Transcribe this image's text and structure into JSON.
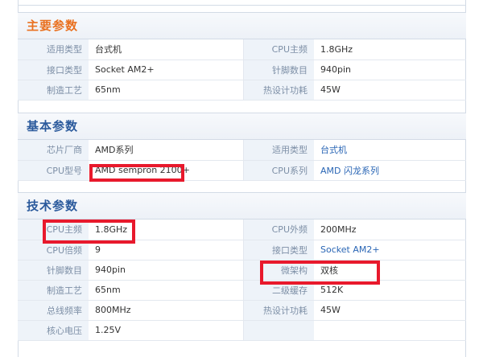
{
  "sections": [
    {
      "title": "主要参数",
      "rows": [
        {
          "k1": "适用类型",
          "v1": "台式机",
          "k2": "CPU主频",
          "v2": "1.8GHz"
        },
        {
          "k1": "接口类型",
          "v1": "Socket AM2+",
          "k2": "针脚数目",
          "v2": "940pin"
        },
        {
          "k1": "制造工艺",
          "v1": "65nm",
          "k2": "热设计功耗",
          "v2": "45W"
        }
      ]
    },
    {
      "title": "基本参数",
      "rows": [
        {
          "k1": "芯片厂商",
          "v1": "AMD系列",
          "k2": "适用类型",
          "v2": "台式机"
        },
        {
          "k1": "CPU型号",
          "v1": "AMD sempron 2100+",
          "k2": "CPU系列",
          "v2": "AMD 闪龙系列"
        }
      ]
    },
    {
      "title": "技术参数",
      "rows": [
        {
          "k1": "CPU主频",
          "v1": "1.8GHz",
          "k2": "CPU外频",
          "v2": "200MHz"
        },
        {
          "k1": "CPU倍频",
          "v1": "9",
          "k2": "接口类型",
          "v2": "Socket AM2+"
        },
        {
          "k1": "针脚数目",
          "v1": "940pin",
          "k2": "微架构",
          "v2": "双核"
        },
        {
          "k1": "制造工艺",
          "v1": "65nm",
          "k2": "二级缓存",
          "v2": "512K"
        },
        {
          "k1": "总线频率",
          "v1": "800MHz",
          "k2": "热设计功耗",
          "v2": "45W"
        },
        {
          "k1": "核心电压",
          "v1": "1.25V",
          "k2": "",
          "v2": ""
        }
      ]
    }
  ],
  "colors": {
    "highlight": "#e8192c",
    "main_title": "#e9701f",
    "sub_title": "#2b5a9c",
    "link": "#2a66b5"
  }
}
